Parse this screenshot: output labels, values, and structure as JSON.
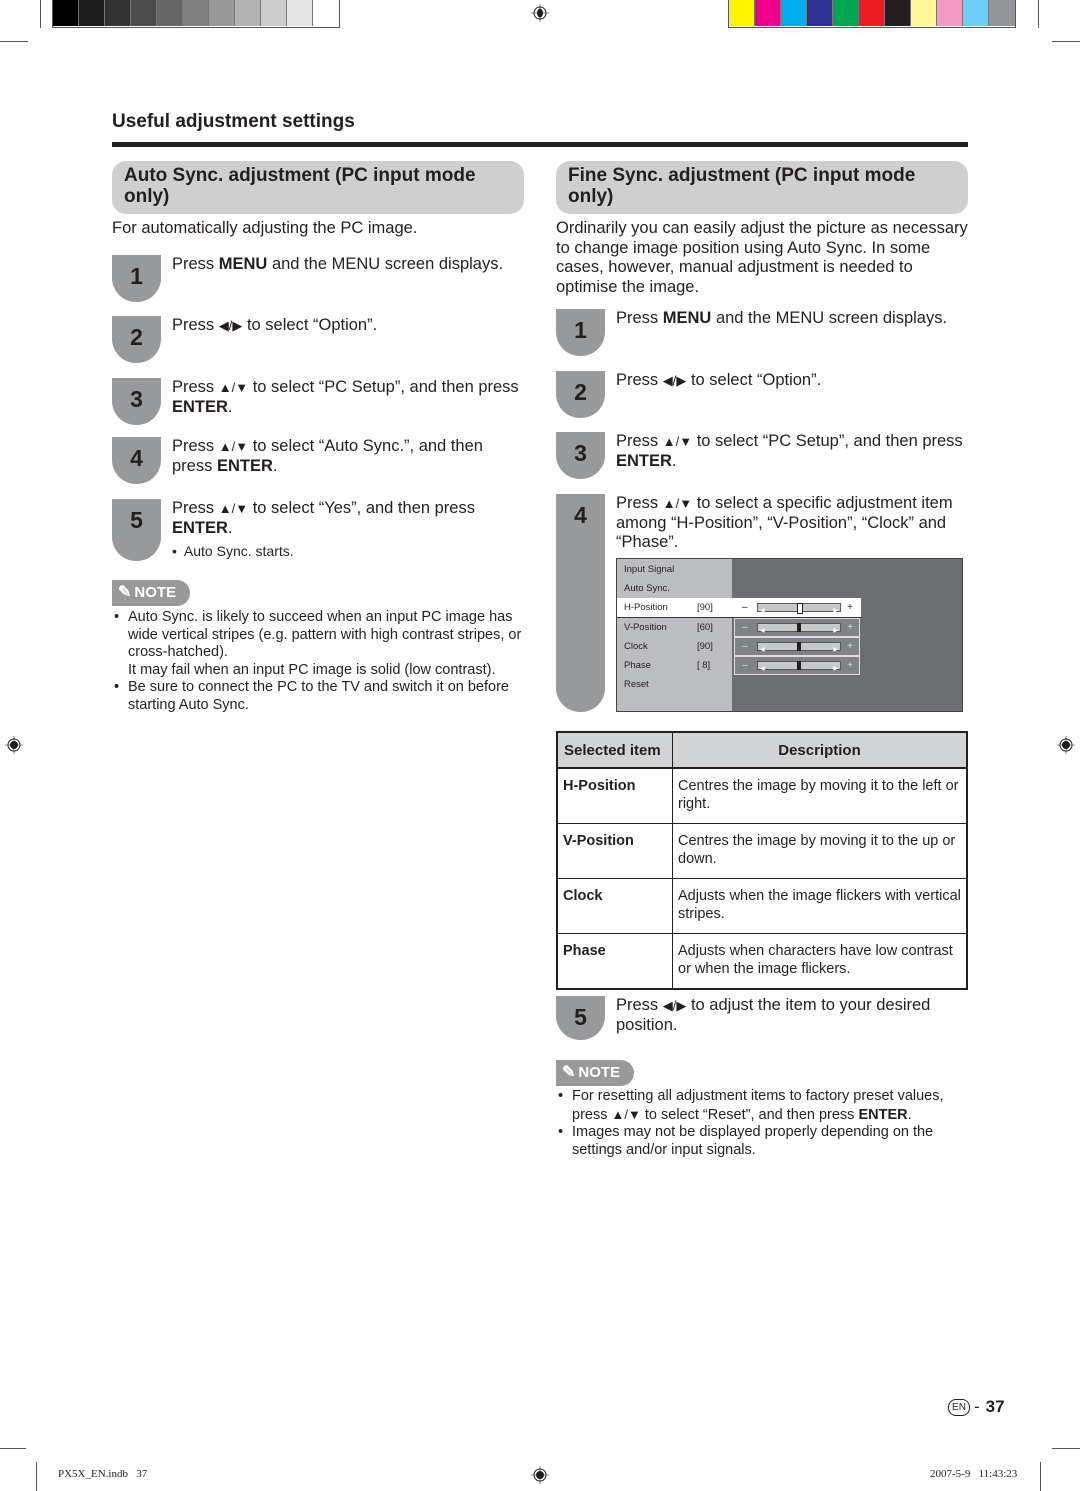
{
  "print_marks": {
    "gray_swatches": [
      "#000000",
      "#1a1a1a",
      "#333333",
      "#4d4d4d",
      "#666666",
      "#808080",
      "#999999",
      "#b3b3b3",
      "#cccccc",
      "#e6e6e6",
      "#ffffff"
    ],
    "color_swatches": [
      "#fff200",
      "#ec008c",
      "#00aeef",
      "#2e3192",
      "#00a651",
      "#ed1c24",
      "#231f20",
      "#fff799",
      "#f49ac1",
      "#6dcff6",
      "#939598"
    ]
  },
  "section_title": "Useful adjustment settings",
  "left": {
    "heading": "Auto Sync. adjustment (PC input mode only)",
    "intro": "For automatically adjusting the PC image.",
    "steps": [
      {
        "num": "1",
        "pre": "Press ",
        "bold": "MENU",
        "post": " and the MENU screen displays."
      },
      {
        "num": "2",
        "pre": "Press ",
        "arrows": "◀/▶",
        "post": " to select “Option”."
      },
      {
        "num": "3",
        "pre": "Press ",
        "arrows": "▲/▼",
        "post": " to select “PC Setup”, and then press ",
        "bold": "ENTER",
        "end": "."
      },
      {
        "num": "4",
        "pre": "Press ",
        "arrows": "▲/▼",
        "post": " to select “Auto Sync.”, and then press ",
        "bold": "ENTER",
        "end": "."
      },
      {
        "num": "5",
        "pre": "Press ",
        "arrows": "▲/▼",
        "post": " to select “Yes”, and then press ",
        "bold": "ENTER",
        "end": ".",
        "sub": "Auto Sync. starts."
      }
    ],
    "note_label": "NOTE",
    "notes": [
      "Auto Sync. is likely to succeed when an input PC image has wide vertical stripes (e.g. pattern with high contrast stripes, or cross-hatched).",
      "It may fail when an input PC image is solid (low contrast).",
      "Be sure to connect the PC to the TV and switch it on before starting Auto Sync."
    ]
  },
  "right": {
    "heading": "Fine Sync. adjustment (PC input mode only)",
    "intro": "Ordinarily you can easily adjust the picture as necessary to change image position using Auto Sync. In some cases, however, manual adjustment is needed to optimise the image.",
    "steps": [
      {
        "num": "1",
        "pre": "Press ",
        "bold": "MENU",
        "post": " and the MENU screen displays."
      },
      {
        "num": "2",
        "pre": "Press ",
        "arrows": "◀/▶",
        "post": " to select “Option”."
      },
      {
        "num": "3",
        "pre": "Press ",
        "arrows": "▲/▼",
        "post": " to select “PC Setup”, and then press ",
        "bold": "ENTER",
        "end": "."
      },
      {
        "num": "4",
        "pre": "Press ",
        "arrows": "▲/▼",
        "post": " to select a specific adjustment item among “H-Position”, “V-Position”, “Clock” and “Phase”."
      },
      {
        "num": "5",
        "pre": "Press ",
        "arrows": "◀/▶",
        "post": " to adjust the item to your desired position."
      }
    ],
    "osd_menu": {
      "items": [
        {
          "label": "Input Signal"
        },
        {
          "label": "Auto Sync."
        },
        {
          "label": "H-Position",
          "value": "[90]",
          "selected": true,
          "slider_fraction": 0.5
        },
        {
          "label": "V-Position",
          "value": "[60]",
          "slider_fraction": 0.5
        },
        {
          "label": "Clock",
          "value": "[90]",
          "slider_fraction": 0.5
        },
        {
          "label": "Phase",
          "value": "[ 8]",
          "slider_fraction": 0.5
        },
        {
          "label": "Reset"
        }
      ],
      "minus": "–",
      "plus": "+"
    },
    "table": {
      "headers": [
        "Selected item",
        "Description"
      ],
      "rows": [
        {
          "item": "H-Position",
          "desc": "Centres the image by moving it to the left or right."
        },
        {
          "item": "V-Position",
          "desc": "Centres the image by moving it to the up or down."
        },
        {
          "item": "Clock",
          "desc": "Adjusts when the image flickers with vertical stripes."
        },
        {
          "item": "Phase",
          "desc": "Adjusts when characters have low contrast or when the image flickers."
        }
      ]
    },
    "note_label": "NOTE",
    "notes": [
      {
        "pre": "For resetting all adjustment items to factory preset values, press ",
        "arrows": "▲/▼",
        "post": " to select “Reset”, and then press ",
        "bold": "ENTER",
        "end": "."
      },
      {
        "pre": "Images may not be displayed properly depending on the settings and/or input signals."
      }
    ]
  },
  "page": {
    "lang": "EN",
    "separator": "-",
    "number": "37"
  },
  "footer": {
    "file": "PX5X_EN.indb   37",
    "timestamp": "2007-5-9   11:43:23"
  }
}
